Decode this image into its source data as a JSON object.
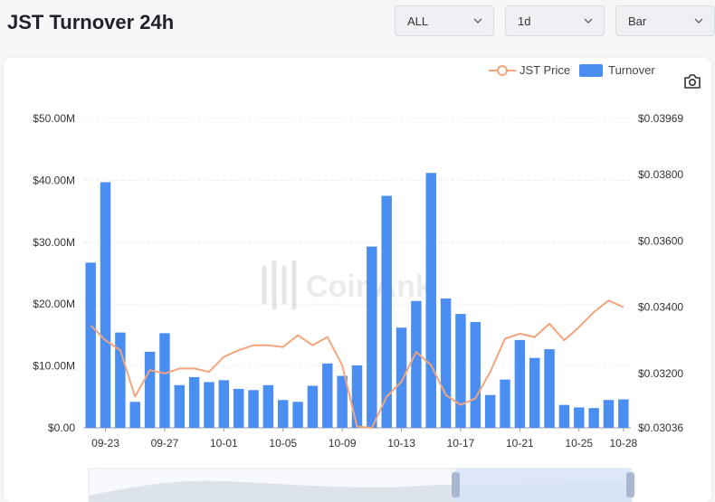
{
  "header": {
    "title": "JST Turnover 24h",
    "dropdowns": [
      {
        "value": "ALL"
      },
      {
        "value": "1d"
      },
      {
        "value": "Bar"
      }
    ]
  },
  "legend": {
    "price_label": "JST Price",
    "turnover_label": "Turnover"
  },
  "icons": {
    "screenshot": "camera-icon",
    "watermark": "coinank-logo"
  },
  "watermark_text": "CoinAnk",
  "colors": {
    "bar": "#4b8ef1",
    "line": "#f4a47c",
    "grid": "#eeeeee"
  },
  "chart_data": {
    "type": "bar",
    "title": "JST Turnover 24h",
    "x": [
      "09-22",
      "09-23",
      "09-24",
      "09-25",
      "09-26",
      "09-27",
      "09-28",
      "09-29",
      "09-30",
      "10-01",
      "10-02",
      "10-03",
      "10-04",
      "10-05",
      "10-06",
      "10-07",
      "10-08",
      "10-09",
      "10-10",
      "10-11",
      "10-12",
      "10-13",
      "10-14",
      "10-15",
      "10-16",
      "10-17",
      "10-18",
      "10-19",
      "10-20",
      "10-21",
      "10-22",
      "10-23",
      "10-24",
      "10-25",
      "10-26",
      "10-27",
      "10-28"
    ],
    "x_tick_labels": [
      "09-23",
      "09-27",
      "10-01",
      "10-05",
      "10-09",
      "10-13",
      "10-17",
      "10-21",
      "10-25",
      "10-28"
    ],
    "series": [
      {
        "name": "Turnover",
        "type": "bar",
        "axis": "left",
        "values": [
          26.7,
          39.7,
          15.4,
          4.2,
          12.3,
          15.3,
          6.9,
          8.2,
          7.4,
          7.7,
          6.3,
          6.1,
          6.9,
          4.5,
          4.2,
          6.8,
          10.4,
          8.4,
          10.1,
          29.3,
          37.5,
          16.2,
          20.5,
          41.2,
          20.9,
          18.4,
          17.1,
          5.3,
          7.8,
          14.2,
          11.3,
          12.7,
          3.7,
          3.3,
          3.2,
          4.5,
          4.6,
          5.0
        ]
      },
      {
        "name": "JST Price",
        "type": "line",
        "axis": "right",
        "values": [
          0.03345,
          0.033,
          0.0327,
          0.0313,
          0.0321,
          0.032,
          0.03215,
          0.03215,
          0.03205,
          0.0325,
          0.0327,
          0.03285,
          0.03285,
          0.0328,
          0.03315,
          0.03285,
          0.0331,
          0.03225,
          0.0304,
          0.03036,
          0.0313,
          0.03175,
          0.03265,
          0.03225,
          0.03135,
          0.03105,
          0.03125,
          0.03205,
          0.03305,
          0.0332,
          0.0331,
          0.0335,
          0.033,
          0.0334,
          0.03385,
          0.0342,
          0.034,
          0.034
        ]
      }
    ],
    "y_left": {
      "ticks": [
        "$0.00",
        "$10.00M",
        "$20.00M",
        "$30.00M",
        "$40.00M",
        "$50.00M"
      ],
      "range": [
        0,
        50
      ]
    },
    "y_right": {
      "ticks": [
        "$0.03036",
        "$0.03200",
        "$0.03400",
        "$0.03600",
        "$0.03800",
        "$0.03969"
      ],
      "range": [
        0.03036,
        0.03969
      ]
    },
    "grid": true,
    "legend_position": "top-right"
  }
}
